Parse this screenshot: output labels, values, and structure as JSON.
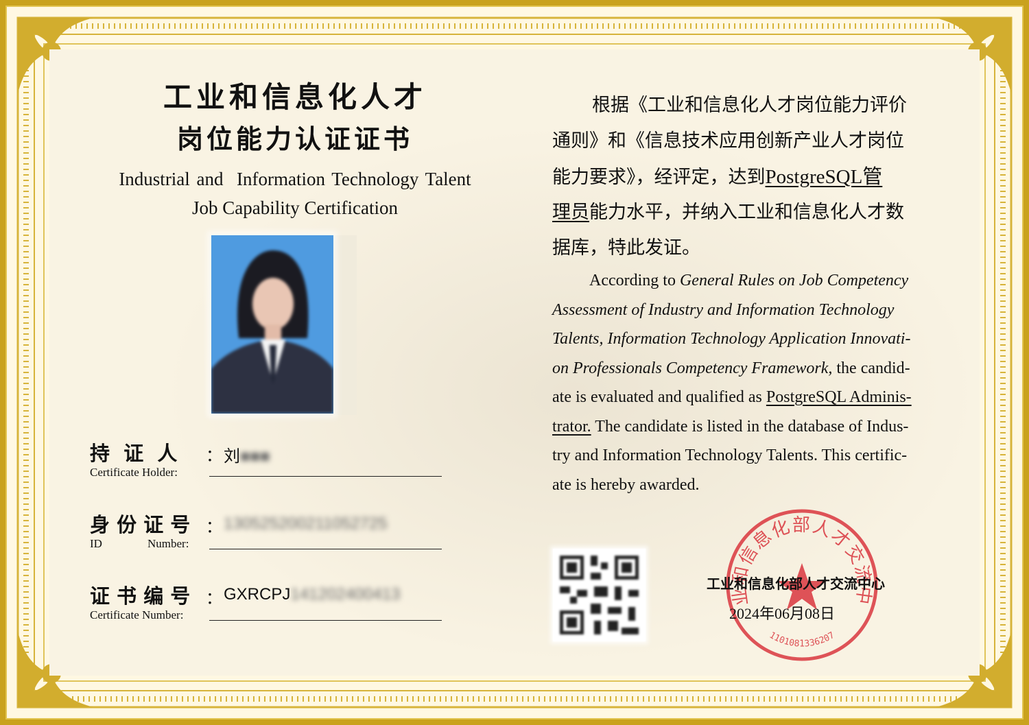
{
  "title": {
    "cn_line1": "工业和信息化人才",
    "cn_line2": "岗位能力认证证书",
    "en_line1": "Industrial and  Information Technology Talent",
    "en_line2": "Job Capability Certification"
  },
  "fields": {
    "holder": {
      "label_cn": "持  证  人",
      "label_en": "Certificate Holder:",
      "value_visible": "刘",
      "value_hidden": "■■■"
    },
    "id_number": {
      "label_cn": "身 份 证 号",
      "label_en_left": "ID",
      "label_en_right": "Number:",
      "value_hidden": "130525200211052725"
    },
    "cert_number": {
      "label_cn": "证 书 编 号",
      "label_en": "Certificate Number:",
      "value_visible": "GXRCPJ",
      "value_hidden": "141202400413"
    },
    "colon": "："
  },
  "statement_cn": {
    "line1": "根据《工业和信息化人才岗位能力评价",
    "line2": "通则》和《信息技术应用创新产业人才岗位",
    "line3_a": "能力要求》，经评定，达到",
    "line3_b": "PostgreSQL管",
    "line4_a": "理员",
    "line4_b": "能力水平，并纳入工业和信息化人才数",
    "line5": "据库，特此发证。"
  },
  "statement_en": {
    "l1_a": "According to ",
    "l1_b": "General Rules on Job Competency",
    "l2": "Assessment of Industry and Information Technology",
    "l3": "Talents, Information Technology Application Innovati-",
    "l4_a": "on Professionals Competency Framework,",
    "l4_b": " the candid-",
    "l5_a": "ate is evaluated and qualified as ",
    "l5_b": "PostgreSQL Adminis-",
    "l6_a": "trator.",
    "l6_b": " The candidate is listed in the database of Indus-",
    "l7": "try and Information Technology Talents. This certific-",
    "l8": "ate is hereby awarded."
  },
  "issuer": {
    "name": "工业和信息化部人才交流中心",
    "date": "2024年06月08日"
  },
  "seal": {
    "ring_text": "工业和信息化部人才交流中心",
    "code": "1101081336207",
    "color": "#d9363e"
  },
  "colors": {
    "frame_gold": "#c9a21d",
    "paper": "#f9f3e3"
  }
}
